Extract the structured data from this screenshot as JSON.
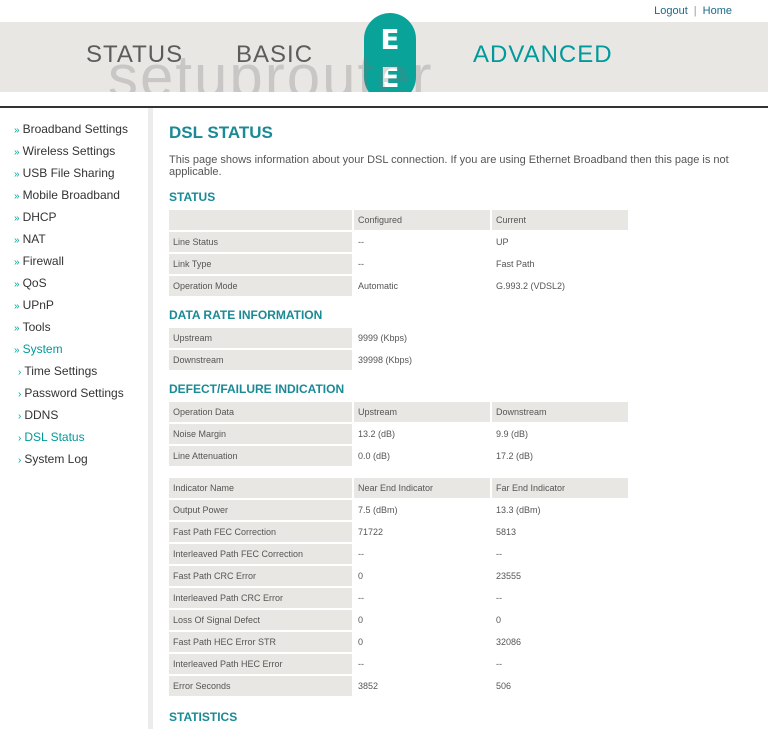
{
  "toplinks": {
    "logout": "Logout",
    "sep": "|",
    "home": "Home"
  },
  "nav": {
    "status": "STATUS",
    "basic": "BASIC",
    "advanced": "ADVANCED"
  },
  "logo": {
    "letter1": "E",
    "letter2": "E"
  },
  "watermark": "setuprouter",
  "sidebar": {
    "items": [
      {
        "label": "Broadband Settings"
      },
      {
        "label": "Wireless Settings"
      },
      {
        "label": "USB File Sharing"
      },
      {
        "label": "Mobile Broadband"
      },
      {
        "label": "DHCP"
      },
      {
        "label": "NAT"
      },
      {
        "label": "Firewall"
      },
      {
        "label": "QoS"
      },
      {
        "label": "UPnP"
      },
      {
        "label": "Tools"
      },
      {
        "label": "System"
      },
      {
        "label": "Time Settings"
      },
      {
        "label": "Password Settings"
      },
      {
        "label": "DDNS"
      },
      {
        "label": "DSL Status"
      },
      {
        "label": "System Log"
      }
    ]
  },
  "page": {
    "title": "DSL STATUS",
    "intro": "This page shows information about your DSL connection. If you are using Ethernet Broadband then this page is not applicable."
  },
  "status": {
    "heading": "STATUS",
    "headers": [
      "",
      "Configured",
      "Current"
    ],
    "rows": [
      [
        "Line Status",
        "--",
        "UP"
      ],
      [
        "Link Type",
        "--",
        "Fast Path"
      ],
      [
        "Operation Mode",
        "Automatic",
        "G.993.2 (VDSL2)"
      ]
    ]
  },
  "datarate": {
    "heading": "DATA RATE INFORMATION",
    "rows": [
      [
        "Upstream",
        "9999 (Kbps)"
      ],
      [
        "Downstream",
        "39998 (Kbps)"
      ]
    ]
  },
  "defect": {
    "heading": "DEFECT/FAILURE INDICATION",
    "headers": [
      "Operation Data",
      "Upstream",
      "Downstream"
    ],
    "rows": [
      [
        "Noise Margin",
        "13.2 (dB)",
        "9.9 (dB)"
      ],
      [
        "Line Attenuation",
        "0.0 (dB)",
        "17.2 (dB)"
      ]
    ],
    "headers2": [
      "Indicator Name",
      "Near End Indicator",
      "Far End Indicator"
    ],
    "rows2": [
      [
        "Output Power",
        "7.5 (dBm)",
        "13.3 (dBm)"
      ],
      [
        "Fast Path FEC Correction",
        "71722",
        "5813"
      ],
      [
        "Interleaved Path FEC Correction",
        "--",
        "--"
      ],
      [
        "Fast Path CRC Error",
        "0",
        "23555"
      ],
      [
        "Interleaved Path CRC Error",
        "--",
        "--"
      ],
      [
        "Loss Of Signal Defect",
        "0",
        "0"
      ],
      [
        "Fast Path HEC Error STR",
        "0",
        "32086"
      ],
      [
        "Interleaved Path HEC Error",
        "--",
        "--"
      ],
      [
        "Error Seconds",
        "3852",
        "506"
      ]
    ]
  },
  "statistics": {
    "heading": "STATISTICS"
  }
}
